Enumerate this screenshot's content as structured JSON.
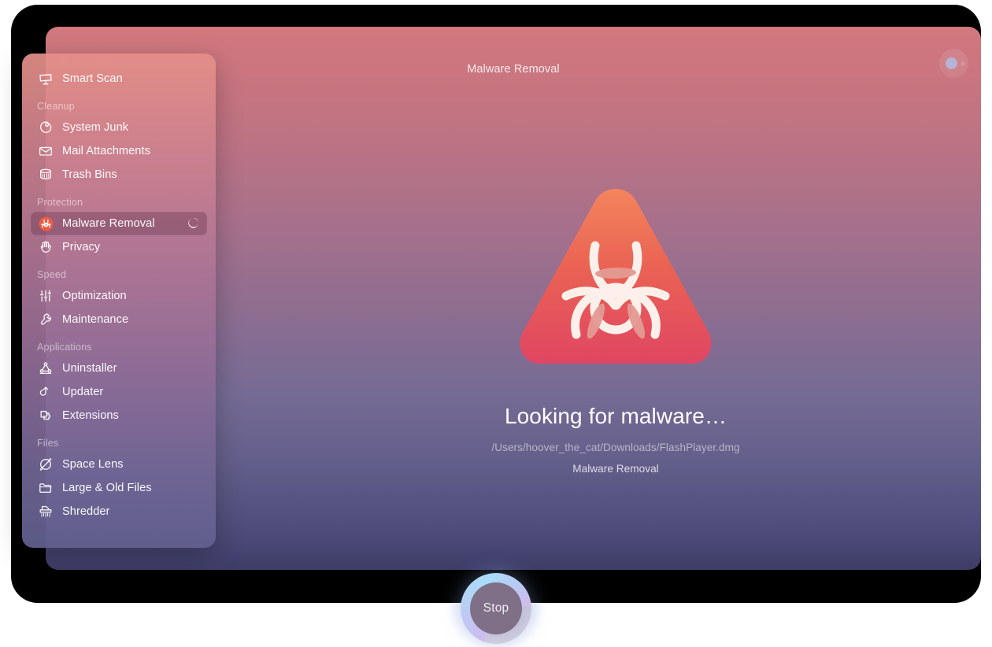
{
  "window": {
    "title": "Malware Removal",
    "traffic_lights": [
      "close",
      "minimize",
      "zoom"
    ],
    "account_button": "account-status-button"
  },
  "sidebar": {
    "groups": [
      {
        "header": null,
        "items": [
          {
            "label": "Smart Scan",
            "icon": "smart-scan-icon",
            "selected": false
          }
        ]
      },
      {
        "header": "Cleanup",
        "items": [
          {
            "label": "System Junk",
            "icon": "system-junk-icon",
            "selected": false
          },
          {
            "label": "Mail Attachments",
            "icon": "mail-attachments-icon",
            "selected": false
          },
          {
            "label": "Trash Bins",
            "icon": "trash-bins-icon",
            "selected": false
          }
        ]
      },
      {
        "header": "Protection",
        "items": [
          {
            "label": "Malware Removal",
            "icon": "biohazard-icon",
            "selected": true,
            "busy": true
          },
          {
            "label": "Privacy",
            "icon": "privacy-hand-icon",
            "selected": false
          }
        ]
      },
      {
        "header": "Speed",
        "items": [
          {
            "label": "Optimization",
            "icon": "sliders-icon",
            "selected": false
          },
          {
            "label": "Maintenance",
            "icon": "wrench-icon",
            "selected": false
          }
        ]
      },
      {
        "header": "Applications",
        "items": [
          {
            "label": "Uninstaller",
            "icon": "uninstaller-icon",
            "selected": false
          },
          {
            "label": "Updater",
            "icon": "updater-arrow-icon",
            "selected": false
          },
          {
            "label": "Extensions",
            "icon": "extensions-puzzle-icon",
            "selected": false
          }
        ]
      },
      {
        "header": "Files",
        "items": [
          {
            "label": "Space Lens",
            "icon": "space-lens-icon",
            "selected": false
          },
          {
            "label": "Large & Old Files",
            "icon": "folder-icon",
            "selected": false
          },
          {
            "label": "Shredder",
            "icon": "shredder-icon",
            "selected": false
          }
        ]
      }
    ]
  },
  "main": {
    "hero_icon": "biohazard-triangle-icon",
    "scan_title": "Looking for malware…",
    "scan_path": "/Users/hoover_the_cat/Downloads/FlashPlayer.dmg",
    "scan_subtitle": "Malware Removal",
    "stop_label": "Stop"
  },
  "colors": {
    "bg_top": "#d2787e",
    "bg_bottom": "#3e3d67",
    "hazard_top": "#f08060",
    "hazard_bottom": "#e0485f",
    "progress_ring": "#aadcfa",
    "stop_center": "#7f6f87"
  }
}
